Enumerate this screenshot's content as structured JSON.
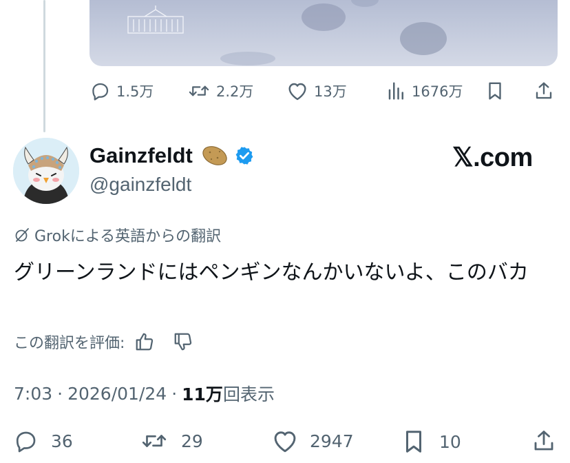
{
  "prev_tweet": {
    "actions": {
      "replies": "1.5万",
      "retweets": "2.2万",
      "likes": "13万",
      "views": "1676万"
    }
  },
  "tweet": {
    "author": {
      "name": "Gainzfeldt",
      "handle": "@gainzfeldt",
      "verified": true
    },
    "source_label": "𝕏.com",
    "translated_by": "Grokによる英語からの翻訳",
    "text": "グリーンランドにはペンギンなんかいないよ、このバカ",
    "rate_translation": "この翻訳を評価:",
    "time": "7:03",
    "date": "2026/01/24",
    "views_count": "11万",
    "views_label": "回表示",
    "separator": "·",
    "actions": {
      "replies": "36",
      "retweets": "29",
      "likes": "2947",
      "bookmarks": "10"
    }
  },
  "colors": {
    "text": "#0f1419",
    "secondary": "#536471",
    "verified": "#1d9bf0",
    "thread_line": "#cfd9de"
  },
  "icons": [
    "reply-icon",
    "retweet-icon",
    "like-icon",
    "views-icon",
    "bookmark-icon",
    "share-icon",
    "verified-badge-icon",
    "potato-emoji-icon",
    "grok-icon",
    "thumbs-up-icon",
    "thumbs-down-icon"
  ]
}
